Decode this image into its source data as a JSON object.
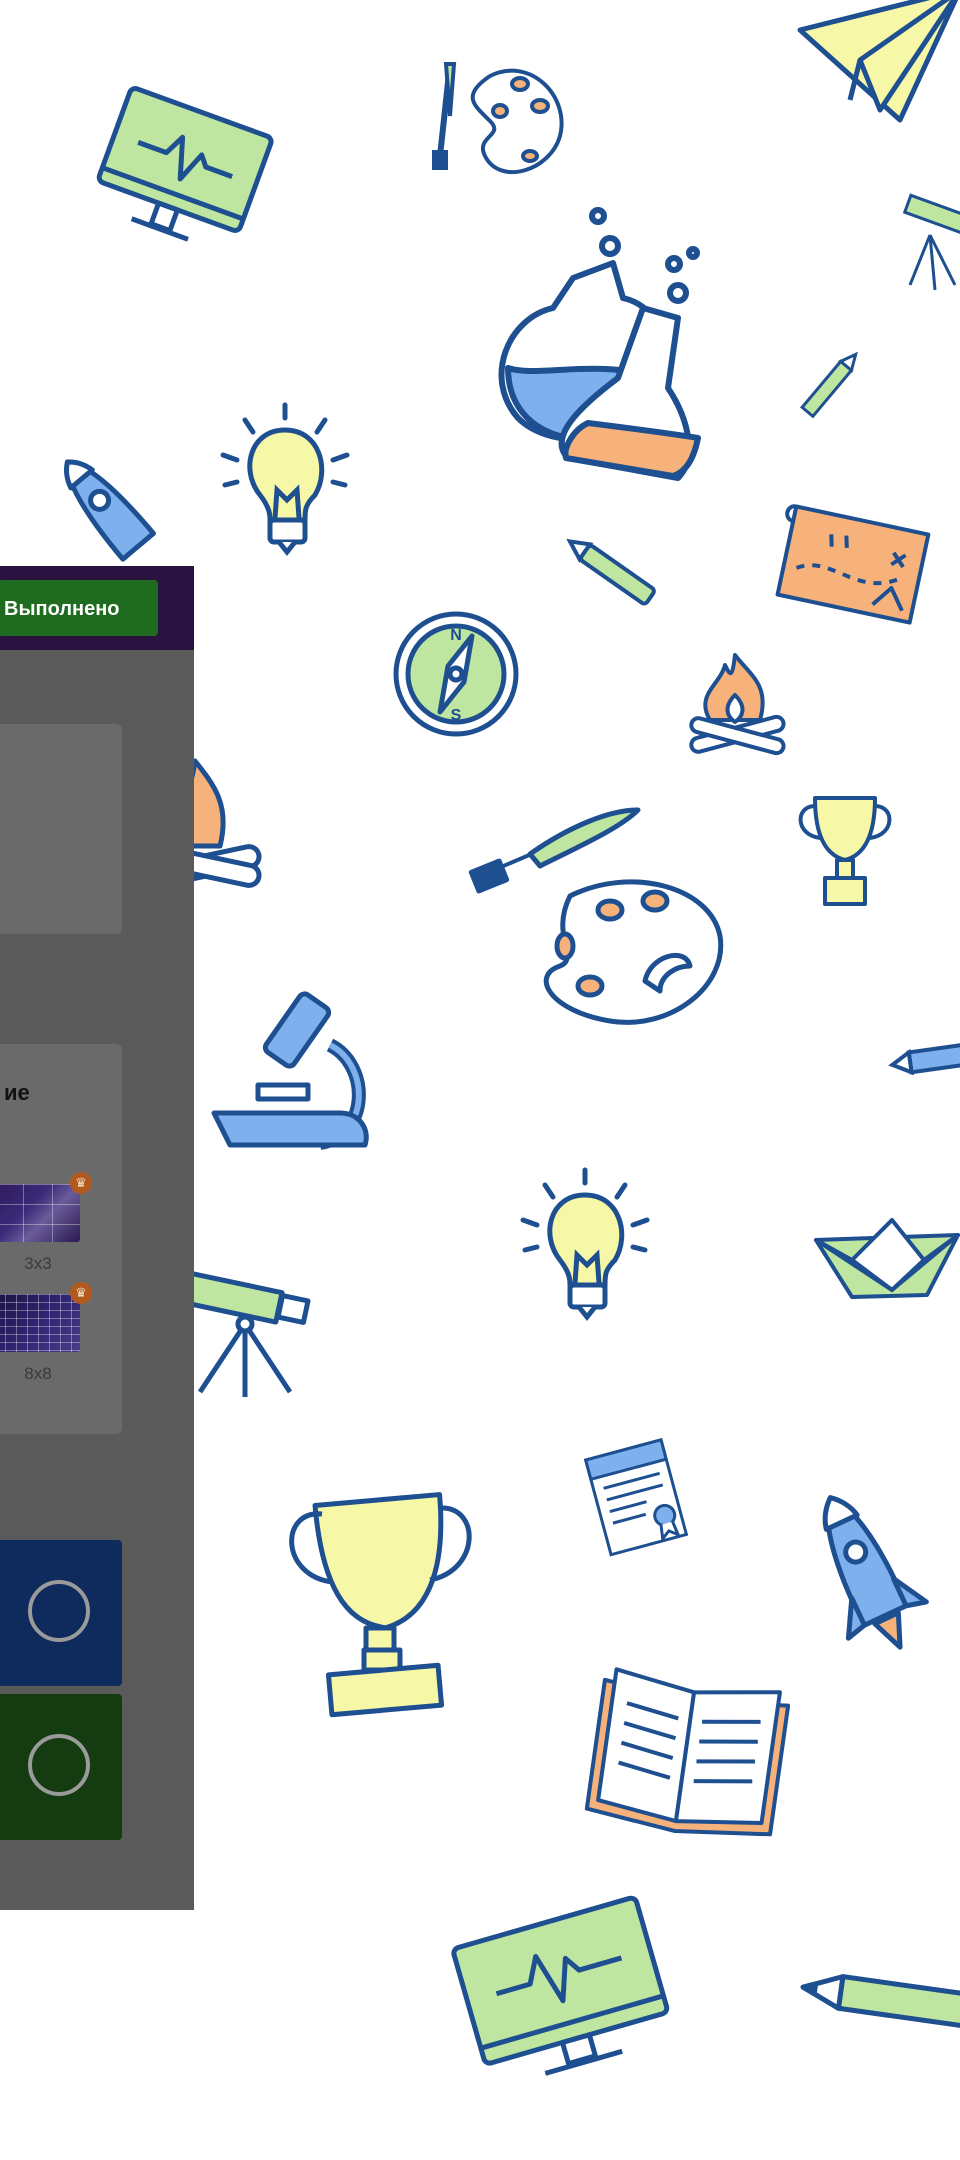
{
  "toolbar": {
    "done_label": "Выполнено"
  },
  "settings": {
    "section_title": "ие",
    "options": [
      {
        "label": "3x3",
        "premium_icon": "crown-icon"
      },
      {
        "label": "8x8",
        "premium_icon": "crown-icon"
      }
    ]
  },
  "answers": [
    {
      "color": "#0f2a5c",
      "icon": "radio-circle-icon"
    },
    {
      "color": "#153c10",
      "icon": "radio-circle-icon"
    }
  ],
  "colors": {
    "doodle_outline": "#1d4f91",
    "doodle_green": "#bfe6a0",
    "doodle_yellow": "#f7f7a8",
    "doodle_blue": "#7fb0ee",
    "doodle_orange": "#f6b27a",
    "topbar": "#2a1240",
    "done_button": "#1f6b1f"
  },
  "background_pattern": [
    "monitor-icon",
    "paint-palette-icon",
    "paper-plane-icon",
    "telescope-icon",
    "chemistry-flasks-icon",
    "pencil-icon",
    "light-bulb-icon",
    "rocket-icon",
    "treasure-map-icon",
    "compass-icon",
    "campfire-icon",
    "trophy-icon",
    "microscope-icon",
    "paper-boat-icon",
    "certificate-icon",
    "open-book-icon"
  ]
}
